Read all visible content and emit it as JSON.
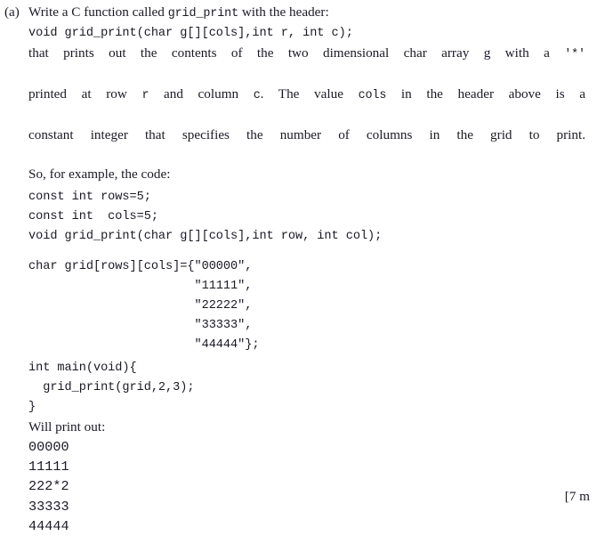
{
  "question": {
    "label": "(a)",
    "intro": {
      "before": "Write a C function called ",
      "code_name": "grid_print",
      "after": " with the header:"
    },
    "header_code": "void grid_print(char g[][cols],int r, int c);",
    "description": {
      "line1_a": "that prints out the contents of the two dimensional char array g with a ",
      "line1_mono": "'*'",
      "line2_a": "printed at row ",
      "line2_mono1": "r",
      "line2_b": " and column ",
      "line2_mono2": "c",
      "line2_c": ". The value ",
      "line2_mono3": "cols",
      "line2_d": " in the header above is a",
      "line3": "constant integer that specifies the number of columns in the grid to print.",
      "line4": "So, for example, the code:"
    },
    "example_code_top": "const int rows=5;\nconst int  cols=5;\nvoid grid_print(char g[][cols],int row, int col);",
    "example_code_array": "char grid[rows][cols]={\"00000\",\n                       \"11111\",\n                       \"22222\",\n                       \"33333\",\n                       \"44444\"};",
    "example_code_main": "int main(void){\n  grid_print(grid,2,3);\n}",
    "will_print_label": "Will print out:",
    "output_lines": [
      "00000",
      "11111",
      "222*2",
      "33333",
      "44444"
    ],
    "marks": "[7 m"
  }
}
